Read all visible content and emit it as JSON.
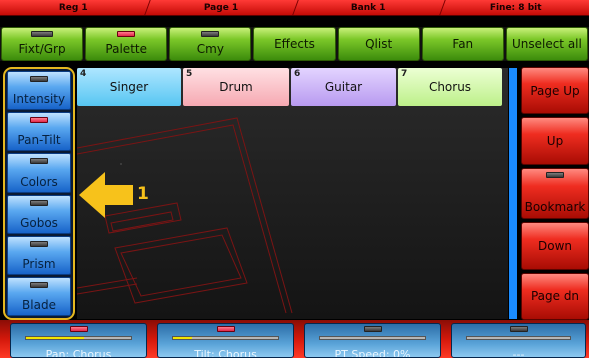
{
  "status_bar": {
    "cells": [
      "Reg 1",
      "Page 1",
      "Bank 1",
      "Fine: 8 bit"
    ]
  },
  "toolbar": {
    "buttons": [
      {
        "label": "Fixt/Grp",
        "led": "gray-wide"
      },
      {
        "label": "Palette",
        "led": "red"
      },
      {
        "label": "Cmy",
        "led": "gray"
      },
      {
        "label": "Effects",
        "led": "none"
      },
      {
        "label": "Qlist",
        "led": "none"
      },
      {
        "label": "Fan",
        "led": "none"
      },
      {
        "label": "Unselect all",
        "led": "none"
      }
    ]
  },
  "fixtures": [
    {
      "number": "4",
      "name": "Singer",
      "color": "#57c6f2"
    },
    {
      "number": "5",
      "name": "Drum",
      "color": "#f6a9b2"
    },
    {
      "number": "6",
      "name": "Guitar",
      "color": "#b89af0"
    },
    {
      "number": "7",
      "name": "Chorus",
      "color": "#bdf089"
    }
  ],
  "left_panel": {
    "buttons": [
      {
        "label": "Intensity",
        "led": "gray"
      },
      {
        "label": "Pan-Tilt",
        "led": "red"
      },
      {
        "label": "Colors",
        "led": "gray"
      },
      {
        "label": "Gobos",
        "led": "gray"
      },
      {
        "label": "Prism",
        "led": "gray"
      },
      {
        "label": "Blade",
        "led": "gray"
      }
    ]
  },
  "right_panel": {
    "buttons": [
      {
        "label": "Page Up"
      },
      {
        "label": "Up"
      },
      {
        "label": "Bookmark",
        "led": "gray"
      },
      {
        "label": "Down"
      },
      {
        "label": "Page dn"
      }
    ]
  },
  "annotation": {
    "label": "1",
    "color": "#f7c21b"
  },
  "encoders": [
    {
      "label": "Pan: Chorus",
      "led": "red",
      "level": 0.55
    },
    {
      "label": "Tilt: Chorus",
      "led": "red",
      "level": 0.18
    },
    {
      "label": "PT Speed: 0%",
      "led": "gray",
      "level": 0
    },
    {
      "label": "---",
      "led": "gray",
      "level": 0
    }
  ],
  "colors": {
    "accent_yellow": "#e5b820",
    "toolbar_green": "#7cc829",
    "panel_blue": "#5aa8f0",
    "panel_red": "#ef2d20"
  }
}
